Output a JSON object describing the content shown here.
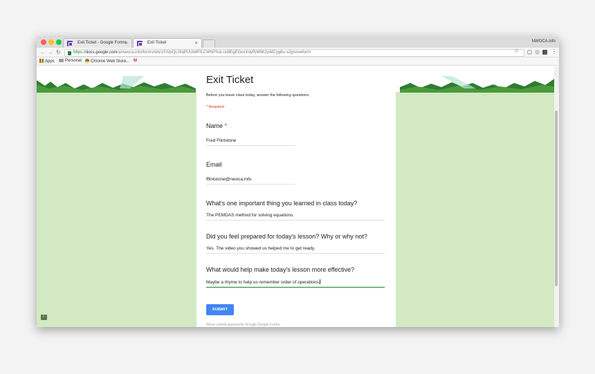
{
  "browser": {
    "tabs": [
      {
        "title": "Exit Ticket - Google Forms",
        "active": false
      },
      {
        "title": "Exit Ticket",
        "active": true
      }
    ],
    "profile_label": "NWOCA.info",
    "url": {
      "secure_label": "https://",
      "host": "docs.google.com",
      "path": "/a/nwoca.info/forms/d/e/1FAIpQLSfaPUUb4FfLCWhPSsk-ix8lEgEGoxXdyRjM6K2pMCyg6u-s2g/viewform"
    },
    "bookmarks": [
      {
        "label": "Apps",
        "icon": "apps-grid-icon"
      },
      {
        "label": "Personal",
        "icon": "folder-icon"
      },
      {
        "label": "Chrome Web Store...",
        "icon": "chrome-web-store-icon"
      },
      {
        "label": "M",
        "icon": "gmail-icon"
      }
    ]
  },
  "form": {
    "title": "Exit Ticket",
    "description": "Before you leave class today, answer the following questions.",
    "required_note": "* Required",
    "questions": [
      {
        "label": "Name",
        "required_mark": "*",
        "answer": "Fred Flintstone"
      },
      {
        "label": "Email",
        "answer": "fflintstone@nwoca.info"
      },
      {
        "label": "What's one important thing you learned in class today?",
        "answer": "The PEMDAS method for solving equations."
      },
      {
        "label": "Did you feel prepared for today's lesson? Why or why not?",
        "answer": "Yes. The video you showed us helped me to get ready."
      },
      {
        "label": "What would help make today's lesson more effective?",
        "answer": "Maybe a rhyme to help us remember order of operations."
      }
    ],
    "submit_label": "SUBMIT",
    "footer_note": "Never submit passwords through Google Forms."
  },
  "colors": {
    "page_background": "#d3e9c3",
    "accent": "#4285f4",
    "required": "#d93025",
    "focus_underline": "#188038"
  }
}
